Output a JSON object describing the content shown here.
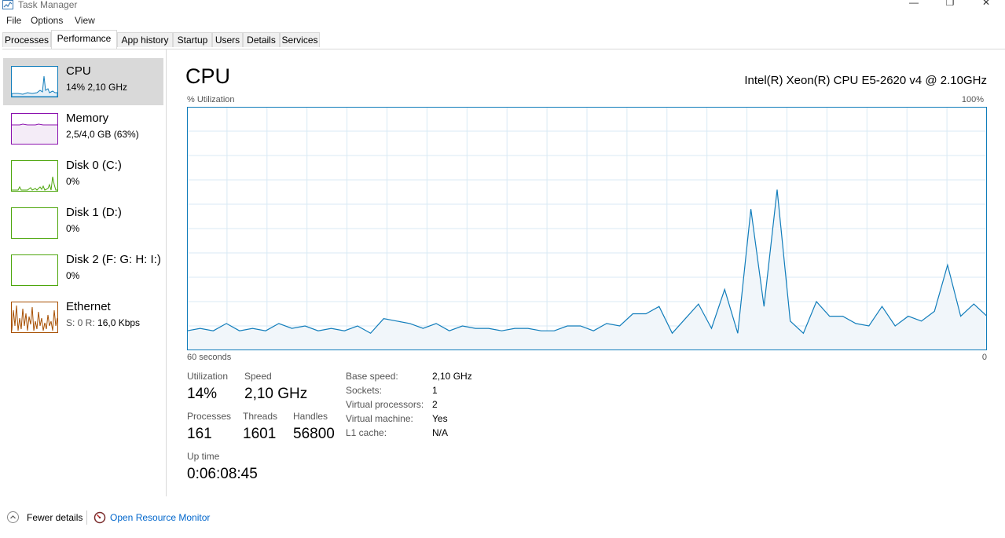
{
  "window": {
    "title": "Task Manager",
    "minimize": "—",
    "maximize": "❐",
    "close": "✕"
  },
  "menu": [
    "File",
    "Options",
    "View"
  ],
  "tabs": [
    "Processes",
    "Performance",
    "App history",
    "Startup",
    "Users",
    "Details",
    "Services"
  ],
  "sidebar": [
    {
      "name": "CPU",
      "value": "14%  2,10 GHz"
    },
    {
      "name": "Memory",
      "value": "2,5/4,0 GB (63%)"
    },
    {
      "name": "Disk 0 (C:)",
      "value": "0%"
    },
    {
      "name": "Disk 1 (D:)",
      "value": "0%"
    },
    {
      "name": "Disk 2 (F: G: H: I:)",
      "value": "0%"
    },
    {
      "name": "Ethernet",
      "value_prefix": "S: 0  R: ",
      "value_main": "16,0 Kbps"
    }
  ],
  "main": {
    "title": "CPU",
    "cpu_model": "Intel(R) Xeon(R) CPU E5-2620 v4 @ 2.10GHz",
    "graph_label": "% Utilization",
    "graph_max": "100%",
    "graph_time": "60 seconds",
    "graph_min": "0"
  },
  "stats": {
    "utilization_label": "Utilization",
    "utilization": "14%",
    "speed_label": "Speed",
    "speed": "2,10 GHz",
    "processes_label": "Processes",
    "processes": "161",
    "threads_label": "Threads",
    "threads": "1601",
    "handles_label": "Handles",
    "handles": "56800",
    "uptime_label": "Up time",
    "uptime": "0:06:08:45"
  },
  "info": [
    {
      "label": "Base speed:",
      "value": "2,10 GHz"
    },
    {
      "label": "Sockets:",
      "value": "1"
    },
    {
      "label": "Virtual processors:",
      "value": "2"
    },
    {
      "label": "Virtual machine:",
      "value": "Yes"
    },
    {
      "label": "L1 cache:",
      "value": "N/A"
    }
  ],
  "footer": {
    "fewer_details": "Fewer details",
    "open_monitor": "Open Resource Monitor"
  },
  "colors": {
    "cpu": "#117dbb",
    "memory": "#8b12ae",
    "disk": "#4da60c",
    "ethernet": "#a74f01",
    "grid": "#d9eaf4",
    "fill": "#f1f6fa"
  },
  "chart_data": {
    "type": "area",
    "x_range": [
      60,
      0
    ],
    "ylim": [
      0,
      100
    ],
    "grid": true,
    "values": [
      8,
      9,
      8,
      11,
      8,
      9,
      8,
      11,
      9,
      10,
      8,
      9,
      8,
      10,
      7,
      13,
      12,
      11,
      9,
      11,
      8,
      10,
      9,
      9,
      8,
      9,
      9,
      8,
      8,
      10,
      10,
      8,
      11,
      10,
      15,
      15,
      18,
      7,
      13,
      19,
      9,
      25,
      7,
      58,
      18,
      66,
      12,
      7,
      20,
      14,
      14,
      11,
      10,
      18,
      10,
      14,
      12,
      16,
      35,
      14,
      19,
      14
    ]
  }
}
